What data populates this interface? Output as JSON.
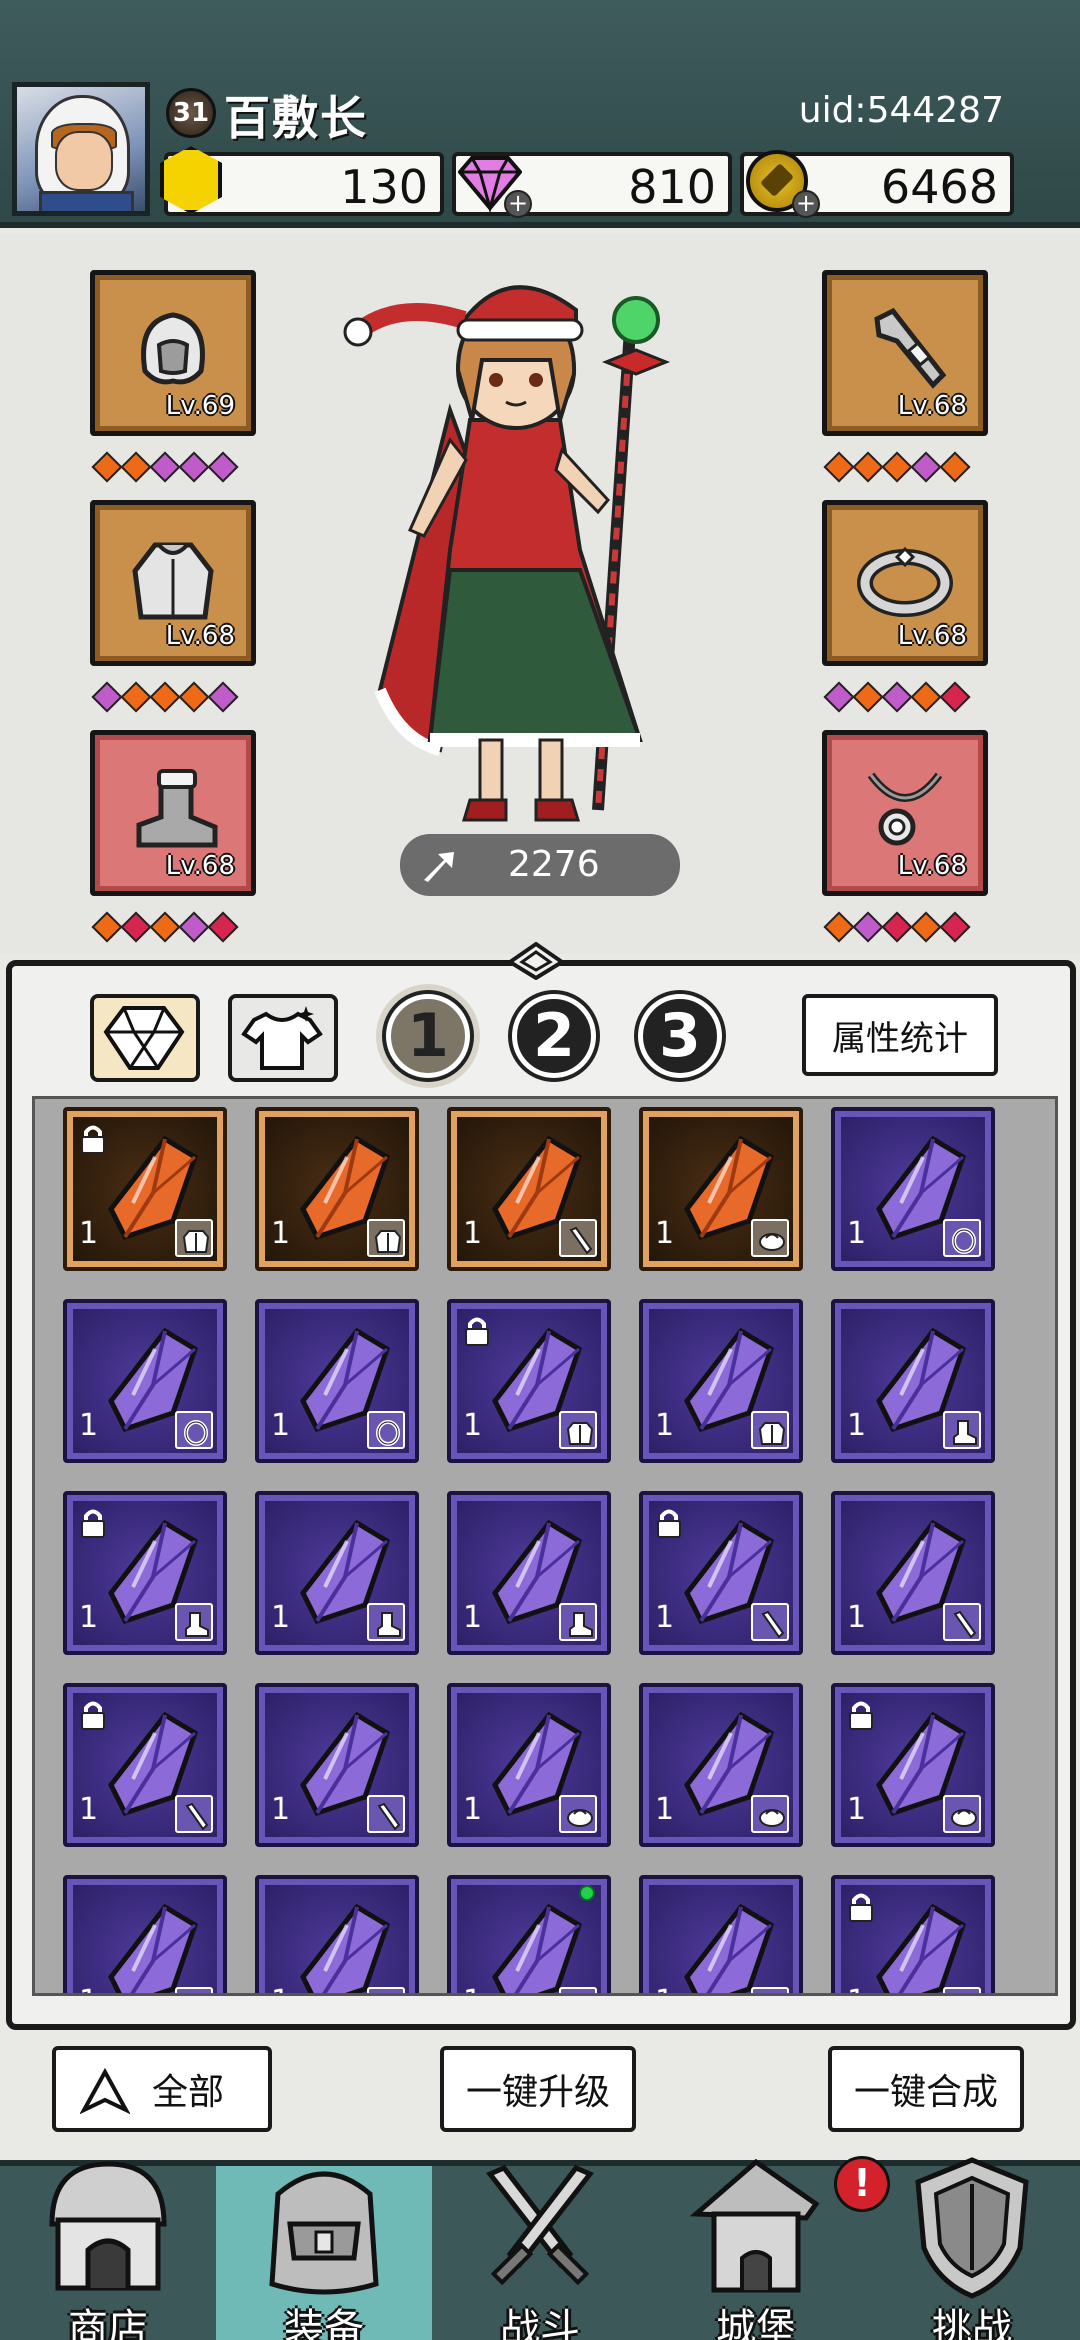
{
  "header": {
    "level": "31",
    "title": "百敷长",
    "uid": "uid:544287",
    "resources": {
      "gold": "130",
      "gems": "810",
      "coins": "6468"
    }
  },
  "equipment": {
    "left_slots": [
      {
        "name": "helmet",
        "level": "Lv.69",
        "icon": "hood-icon",
        "gems": [
          "orange",
          "orange",
          "purple",
          "purple",
          "purple"
        ]
      },
      {
        "name": "armor",
        "level": "Lv.68",
        "icon": "cape-icon",
        "gems": [
          "purple",
          "orange",
          "orange",
          "orange",
          "purple"
        ]
      },
      {
        "name": "boots",
        "level": "Lv.68",
        "icon": "boot-icon",
        "gems": [
          "orange",
          "red",
          "orange",
          "purple",
          "red"
        ]
      }
    ],
    "right_slots": [
      {
        "name": "weapon",
        "level": "Lv.68",
        "icon": "staff-icon",
        "gems": [
          "orange",
          "orange",
          "orange",
          "purple",
          "orange"
        ]
      },
      {
        "name": "ring",
        "level": "Lv.68",
        "icon": "ring-icon",
        "gems": [
          "purple",
          "orange",
          "purple",
          "orange",
          "red"
        ]
      },
      {
        "name": "necklace",
        "level": "Lv.68",
        "icon": "necklace-icon",
        "gems": [
          "orange",
          "purple",
          "red",
          "orange",
          "red"
        ]
      }
    ],
    "power": "2276"
  },
  "inventory": {
    "tabs": [
      "1",
      "2",
      "3"
    ],
    "active_tab": "1",
    "stats_button": "属性统计",
    "items": [
      {
        "rarity": "orange",
        "qty": "1",
        "type": "armor",
        "locked": true
      },
      {
        "rarity": "orange",
        "qty": "1",
        "type": "armor",
        "locked": false
      },
      {
        "rarity": "orange",
        "qty": "1",
        "type": "weapon",
        "locked": false
      },
      {
        "rarity": "orange",
        "qty": "1",
        "type": "helmet",
        "locked": false
      },
      {
        "rarity": "purple",
        "qty": "1",
        "type": "ring",
        "locked": false
      },
      {
        "rarity": "purple",
        "qty": "1",
        "type": "ring",
        "locked": false
      },
      {
        "rarity": "purple",
        "qty": "1",
        "type": "ring",
        "locked": false
      },
      {
        "rarity": "purple",
        "qty": "1",
        "type": "armor",
        "locked": true
      },
      {
        "rarity": "purple",
        "qty": "1",
        "type": "armor",
        "locked": false
      },
      {
        "rarity": "purple",
        "qty": "1",
        "type": "boots",
        "locked": false
      },
      {
        "rarity": "purple",
        "qty": "1",
        "type": "boots",
        "locked": true
      },
      {
        "rarity": "purple",
        "qty": "1",
        "type": "boots",
        "locked": false
      },
      {
        "rarity": "purple",
        "qty": "1",
        "type": "boots",
        "locked": false
      },
      {
        "rarity": "purple",
        "qty": "1",
        "type": "weapon",
        "locked": true
      },
      {
        "rarity": "purple",
        "qty": "1",
        "type": "weapon",
        "locked": false
      },
      {
        "rarity": "purple",
        "qty": "1",
        "type": "weapon",
        "locked": true
      },
      {
        "rarity": "purple",
        "qty": "1",
        "type": "weapon",
        "locked": false
      },
      {
        "rarity": "purple",
        "qty": "1",
        "type": "helmet",
        "locked": false
      },
      {
        "rarity": "purple",
        "qty": "1",
        "type": "helmet",
        "locked": false
      },
      {
        "rarity": "purple",
        "qty": "1",
        "type": "helmet",
        "locked": true
      },
      {
        "rarity": "purple",
        "qty": "1",
        "type": "boots",
        "locked": false
      },
      {
        "rarity": "purple",
        "qty": "1",
        "type": "boots",
        "locked": false
      },
      {
        "rarity": "purple",
        "qty": "1",
        "type": "boots",
        "locked": false,
        "new": true
      },
      {
        "rarity": "purple",
        "qty": "1",
        "type": "boots",
        "locked": false
      },
      {
        "rarity": "purple",
        "qty": "1",
        "type": "boots",
        "locked": true
      }
    ]
  },
  "actions": {
    "filter_all": "全部",
    "upgrade_all": "一键升级",
    "merge_all": "一键合成"
  },
  "nav": [
    {
      "label": "商店",
      "icon": "shop-icon",
      "active": false
    },
    {
      "label": "装备",
      "icon": "bag-icon",
      "active": true
    },
    {
      "label": "战斗",
      "icon": "swords-icon",
      "active": false
    },
    {
      "label": "城堡",
      "icon": "castle-icon",
      "active": false,
      "alert": "!"
    },
    {
      "label": "挑战",
      "icon": "shield-icon",
      "active": false
    }
  ],
  "colors": {
    "header_bg": "#3f5c5c",
    "gem_orange": "#ef6a17",
    "gem_purple": "#c05cc9",
    "gem_red": "#d6264f",
    "nav_active": "#6fb9b6"
  }
}
